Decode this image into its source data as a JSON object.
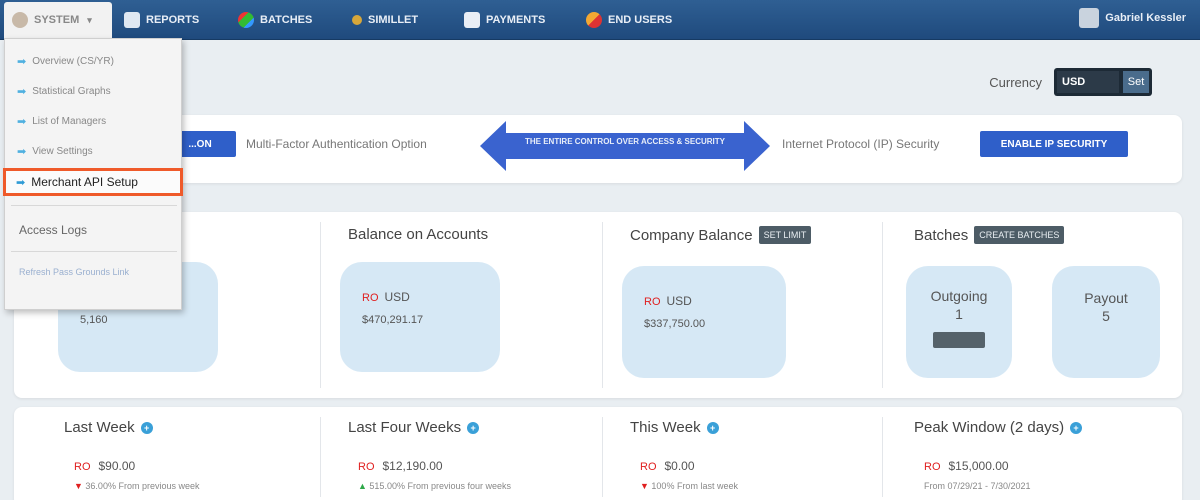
{
  "nav": {
    "items": [
      {
        "label": "SYSTEM",
        "icon": "gear-icon"
      },
      {
        "label": "REPORTS",
        "icon": "document-icon"
      },
      {
        "label": "BATCHES",
        "icon": "batches-icon"
      },
      {
        "label": "SIMILLET",
        "icon": "wallet-icon"
      },
      {
        "label": "PAYMENTS",
        "icon": "payments-icon"
      },
      {
        "label": "END USERS",
        "icon": "users-icon"
      }
    ],
    "user_name": "Gabriel Kessler"
  },
  "dropdown": {
    "items": [
      "Overview (CS/YR)",
      "Statistical Graphs",
      "List of Managers",
      "View Settings",
      "Merchant API Setup"
    ],
    "access_logs": "Access Logs",
    "footer_link": "Refresh Pass Grounds Link"
  },
  "currency": {
    "label": "Currency",
    "value": "USD",
    "button": "Set"
  },
  "security": {
    "left_button": "...ON",
    "mfa_text": "Multi-Factor Authentication Option",
    "arrow_text": "THE ENTIRE CONTROL OVER ACCESS & SECURITY",
    "ip_text": "Internet Protocol (IP) Security",
    "right_button": "ENABLE IP SECURITY"
  },
  "stats": {
    "col1": {
      "amount": "5,160"
    },
    "balance": {
      "title": "Balance on Accounts",
      "currency": "USD",
      "amount": "$470,291.17"
    },
    "company": {
      "title": "Company Balance",
      "badge": "SET LIMIT",
      "currency": "USD",
      "amount": "$337,750.00"
    },
    "batches": {
      "title": "Batches",
      "badge": "Create Batches",
      "outgoing_label": "Outgoing",
      "outgoing_count": "1",
      "payout_label": "Payout",
      "payout_count": "5"
    }
  },
  "periods": [
    {
      "title": "Last Week",
      "currency": "RO",
      "amount": "$90.00",
      "sub": "36.00% From previous week",
      "trend": "down"
    },
    {
      "title": "Last Four Weeks",
      "currency": "RO",
      "amount": "$12,190.00",
      "sub": "515.00% From previous four weeks",
      "trend": "up"
    },
    {
      "title": "This Week",
      "currency": "RO",
      "amount": "$0.00",
      "sub": "100% From last week",
      "trend": "down"
    },
    {
      "title": "Peak Window (2 days)",
      "currency": "RO",
      "amount": "$15,000.00",
      "sub": "From 07/29/21 - 7/30/2021",
      "trend": "none"
    }
  ],
  "colors": {
    "nav": "#2a5689",
    "highlight_border": "#ef5a2a",
    "card": "#d6e8f5",
    "button": "#2f5fc9"
  }
}
